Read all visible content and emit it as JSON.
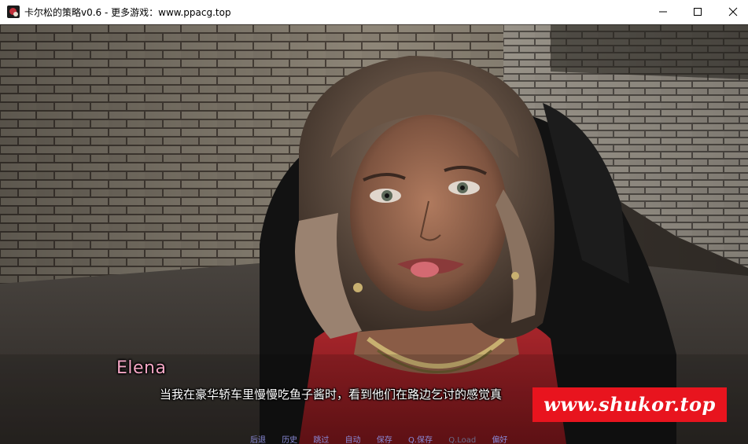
{
  "window": {
    "title": "卡尔松的策略v0.6 - 更多游戏：www.ppacg.top"
  },
  "dialogue": {
    "speaker": "Elena",
    "speaker_color": "#f4a6c4",
    "text": "当我在豪华轿车里慢慢吃鱼子酱时，看到他们在路边乞讨的感觉真"
  },
  "watermark": {
    "text": "www.shukor.top",
    "background": "#e8141e"
  },
  "quick_menu": {
    "items": [
      {
        "label": "后退",
        "enabled": true
      },
      {
        "label": "历史",
        "enabled": true
      },
      {
        "label": "跳过",
        "enabled": true
      },
      {
        "label": "自动",
        "enabled": true
      },
      {
        "label": "保存",
        "enabled": true
      },
      {
        "label": "Q.保存",
        "enabled": true
      },
      {
        "label": "Q.Load",
        "enabled": false
      },
      {
        "label": "偏好",
        "enabled": true
      }
    ],
    "color": "#8a8ad8"
  },
  "icons": {
    "app": "game-app-icon",
    "minimize": "minimize-icon",
    "maximize": "maximize-icon",
    "close": "close-icon"
  }
}
